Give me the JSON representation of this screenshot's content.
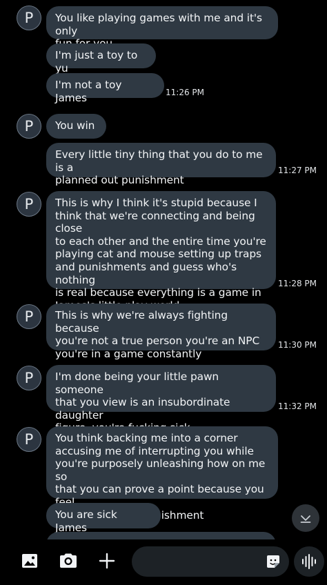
{
  "conversation": {
    "groups": [
      {
        "avatar_letter": "P",
        "messages": [
          "You like playing games with me and it's only\nfun for you",
          "I'm just a toy to yu",
          "I'm not a toy James"
        ],
        "time": "11:26 PM"
      },
      {
        "avatar_letter": "P",
        "messages": [
          "You win",
          "Every little tiny thing that you do to me is a\nplanned out punishment"
        ],
        "time": "11:27 PM"
      },
      {
        "avatar_letter": "P",
        "messages": [
          "This is why I think it's stupid because I\nthink that we're connecting and being close\nto each other and the entire time you're\nplaying cat and mouse setting up traps\nand punishments and guess who's nothing\nis real because everything is a game in\nJames's little play world"
        ],
        "time": "11:28 PM"
      },
      {
        "avatar_letter": "P",
        "messages": [
          "This is why we're always fighting because\nyou're not a true person you're an NPC\nyou're in a game constantly"
        ],
        "time": "11:30 PM"
      },
      {
        "avatar_letter": "P",
        "messages": [
          "I'm done being your little pawn someone\nthat you view is an insubordinate daughter\nfigure, you're fucking sick"
        ],
        "time": "11:32 PM"
      },
      {
        "avatar_letter": "P",
        "messages": [
          "You think backing me into a corner\naccusing me of interrupting you while\nyou're purposely unleashing how on me so\nthat you can prove a point because you feel\nthat I deserve a punishment",
          "You are sick James"
        ],
        "time": ""
      }
    ]
  },
  "composer": {
    "placeholder": "",
    "icons": {
      "gallery": "gallery-icon",
      "camera": "camera-icon",
      "plus": "plus-icon",
      "sticker": "sticker-icon",
      "voice": "voice-wave-icon",
      "scroll_down": "scroll-down-icon"
    }
  },
  "colors": {
    "background": "#000000",
    "bubble": "#2f3943",
    "text": "#f2f4f6",
    "avatar_border": "#6b7785"
  }
}
